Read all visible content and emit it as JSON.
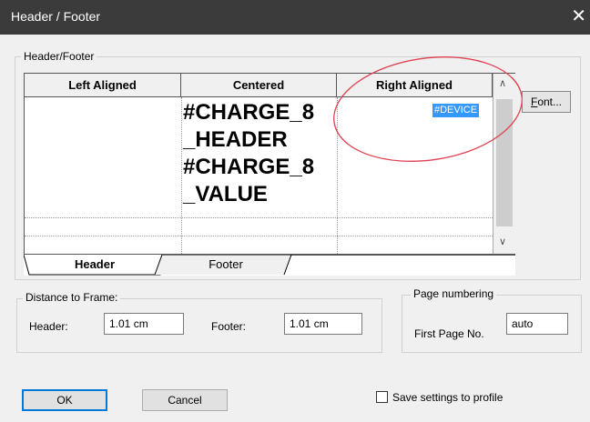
{
  "window": {
    "title": "Header / Footer",
    "close_glyph": "✕"
  },
  "header_footer_group": {
    "label": "Header/Footer"
  },
  "grid": {
    "columns": [
      "Left Aligned",
      "Centered",
      "Right Aligned"
    ],
    "centered_text": [
      "#CHARGE_8",
      "_HEADER",
      "#CHARGE_8",
      "_VALUE"
    ],
    "right_selected_text": "#DEVICE"
  },
  "font_button": {
    "label": "Font...",
    "accel": "F"
  },
  "tabs": {
    "header": "Header",
    "footer": "Footer"
  },
  "distance_group": {
    "label": "Distance to Frame:",
    "header_label": "Header:",
    "header_value": "1.01 cm",
    "footer_label": "Footer:",
    "footer_value": "1.01 cm"
  },
  "page_numbering": {
    "label": "Page numbering",
    "first_page_label": "First Page No.",
    "first_page_value": "auto"
  },
  "buttons": {
    "ok": "OK",
    "cancel": "Cancel"
  },
  "save_settings": {
    "label": "Save settings to profile",
    "checked": false
  },
  "annotation": {
    "color": "#e0404f"
  }
}
